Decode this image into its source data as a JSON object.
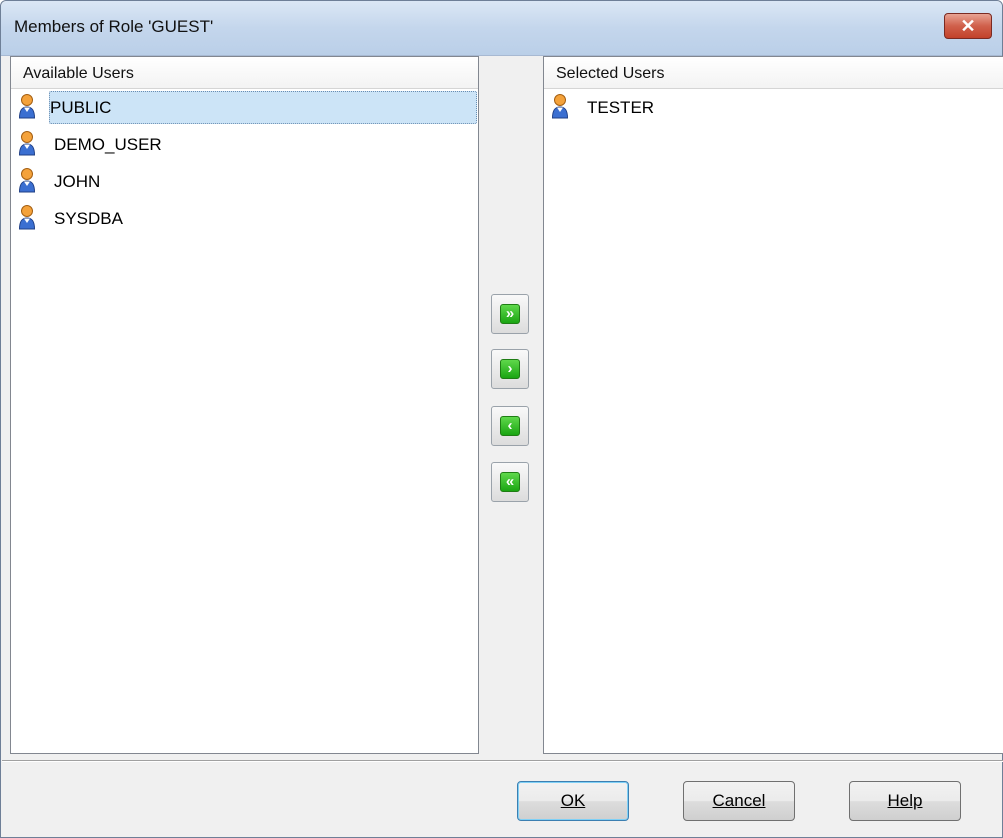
{
  "window": {
    "title": "Members of Role 'GUEST'",
    "close_label": "✕"
  },
  "available": {
    "header": "Available Users",
    "items": [
      {
        "label": "PUBLIC",
        "icon": "user-icon",
        "selected": true
      },
      {
        "label": "DEMO_USER",
        "icon": "user-icon",
        "selected": false
      },
      {
        "label": "JOHN",
        "icon": "user-icon",
        "selected": false
      },
      {
        "label": "SYSDBA",
        "icon": "user-icon",
        "selected": false
      }
    ]
  },
  "selected": {
    "header": "Selected Users",
    "items": [
      {
        "label": "TESTER",
        "icon": "user-icon"
      }
    ]
  },
  "transfer": {
    "add_all": "»",
    "add": "›",
    "remove": "‹",
    "remove_all": "«"
  },
  "buttons": {
    "ok": "OK",
    "cancel": "Cancel",
    "help": "Help"
  },
  "colors": {
    "selection": "#cce4f7",
    "arrow_green": "#1aa512",
    "close_red": "#c2412a",
    "title_bar": "#c4d6ec"
  }
}
